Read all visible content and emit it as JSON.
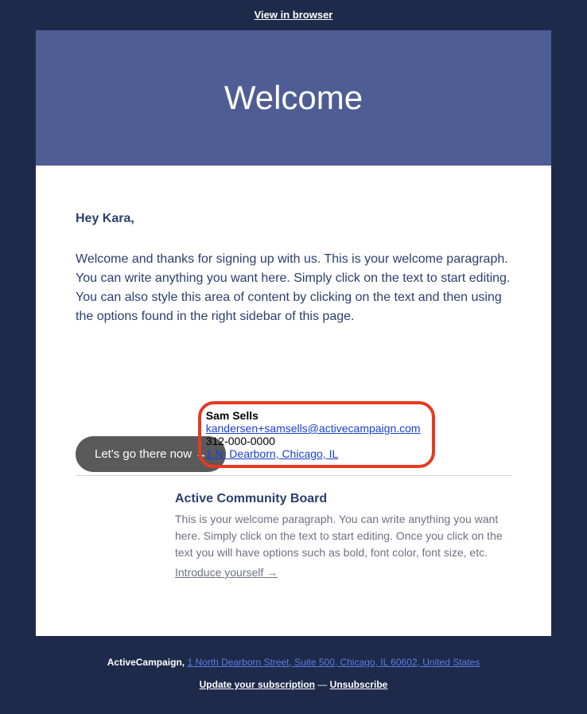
{
  "topBar": {
    "viewInBrowser": "View in browser"
  },
  "hero": {
    "title": "Welcome"
  },
  "content": {
    "greeting": "Hey Kara,",
    "welcomeParagraph": "Welcome and thanks for signing up with us. This is your welcome paragraph. You can write anything you want here. Simply click on the text to start editing. You can also style this area of content by clicking on the text and then using the options found in the right sidebar of this page.",
    "ctaLabel": "Let's go there now →"
  },
  "sender": {
    "name": "Sam Sells",
    "email": "kandersen+samsells@activecampaign.com",
    "phone": "312-000-0000",
    "address": "1 N. Dearborn, Chicago, IL"
  },
  "community": {
    "title": "Active Community Board",
    "text": "This is your welcome paragraph. You can write anything you want here. Simply click on the text to start editing. Once you click on the text you will have options such as bold, font color, font size, etc.",
    "linkText": "Introduce yourself →"
  },
  "footer": {
    "company": "ActiveCampaign,",
    "address": "1 North Dearborn Street, Suite 500, Chicago, IL 60602, United States",
    "updateSubscription": "Update your subscription",
    "separator": " — ",
    "unsubscribe": "Unsubscribe"
  }
}
